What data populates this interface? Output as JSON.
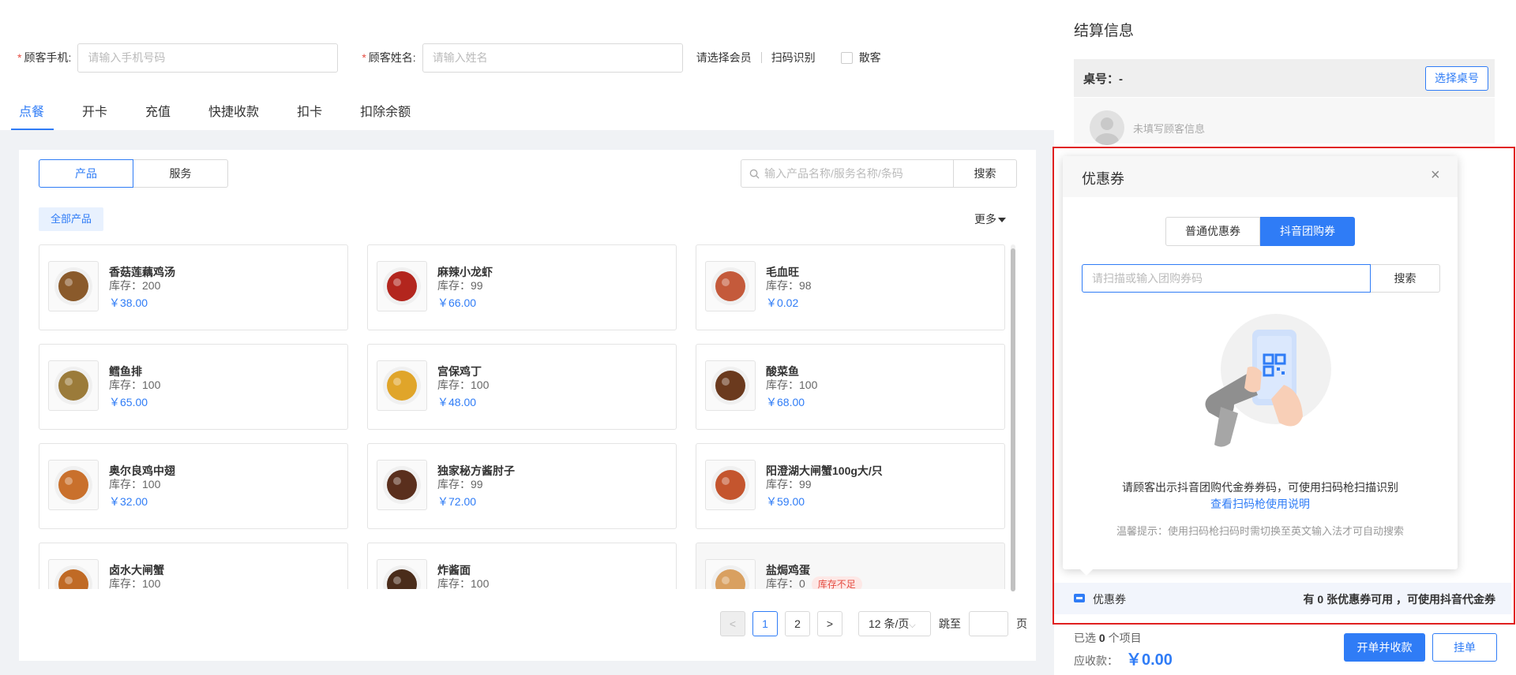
{
  "form": {
    "phone_label": "顾客手机:",
    "phone_placeholder": "请输入手机号码",
    "name_label": "顾客姓名:",
    "name_placeholder": "请输入姓名",
    "select_member": "请选择会员",
    "scan_identify": "扫码识别",
    "walk_in": "散客",
    "required_mark": "*"
  },
  "tabs": [
    "点餐",
    "开卡",
    "充值",
    "快捷收款",
    "扣卡",
    "扣除余额"
  ],
  "segment": {
    "product": "产品",
    "service": "服务"
  },
  "search": {
    "placeholder": "输入产品名称/服务名称/条码",
    "button": "搜索"
  },
  "category": "全部产品",
  "more": "更多",
  "products": [
    {
      "name": "香菇莲藕鸡汤",
      "stock": "库存：200",
      "price": "￥38.00"
    },
    {
      "name": "麻辣小龙虾",
      "stock": "库存：99",
      "price": "￥66.00"
    },
    {
      "name": "毛血旺",
      "stock": "库存：98",
      "price": "￥0.02"
    },
    {
      "name": "鳕鱼排",
      "stock": "库存：100",
      "price": "￥65.00"
    },
    {
      "name": "宫保鸡丁",
      "stock": "库存：100",
      "price": "￥48.00"
    },
    {
      "name": "酸菜鱼",
      "stock": "库存：100",
      "price": "￥68.00"
    },
    {
      "name": "奥尔良鸡中翅",
      "stock": "库存：100",
      "price": "￥32.00"
    },
    {
      "name": "独家秘方酱肘子",
      "stock": "库存：99",
      "price": "￥72.00"
    },
    {
      "name": "阳澄湖大闸蟹100g大/只",
      "stock": "库存：99",
      "price": "￥59.00"
    },
    {
      "name": "卤水大闸蟹",
      "stock": "库存：100",
      "price": ""
    },
    {
      "name": "炸酱面",
      "stock": "库存：100",
      "price": ""
    },
    {
      "name": "盐焗鸡蛋",
      "stock": "库存：0",
      "price": "",
      "badge": "库存不足"
    }
  ],
  "pager": {
    "prev": "<",
    "pages": [
      "1",
      "2"
    ],
    "next": ">",
    "page_size": "12 条/页",
    "jump_label": "跳至",
    "page_suffix": "页"
  },
  "settlement": {
    "title": "结算信息",
    "desk_label": "桌号：-",
    "select_desk": "选择桌号",
    "customer_placeholder": "未填写顾客信息",
    "selected_prefix": "已选",
    "selected_count": "0",
    "selected_suffix": "个项目",
    "due_label": "应收款：",
    "due_amount": "￥0.00",
    "checkout_button": "开单并收款",
    "hold_button": "挂单"
  },
  "coupon_bar": {
    "label": "优惠券",
    "info": "有 0 张优惠券可用 ，可使用抖音代金券"
  },
  "popover": {
    "title": "优惠券",
    "close": "×",
    "tab_normal": "普通优惠券",
    "tab_douyin": "抖音团购券",
    "input_placeholder": "请扫描或输入团购券码",
    "search_button": "搜索",
    "description": "请顾客出示抖音团购代金券券码，可使用扫码枪扫描识别",
    "help_link": "查看扫码枪使用说明",
    "tip": "温馨提示：使用扫码枪扫码时需切换至英文输入法才可自动搜索"
  },
  "colors": {
    "accent": "#2f7cf6",
    "danger": "#e54d42",
    "highlight": "#e02020"
  }
}
